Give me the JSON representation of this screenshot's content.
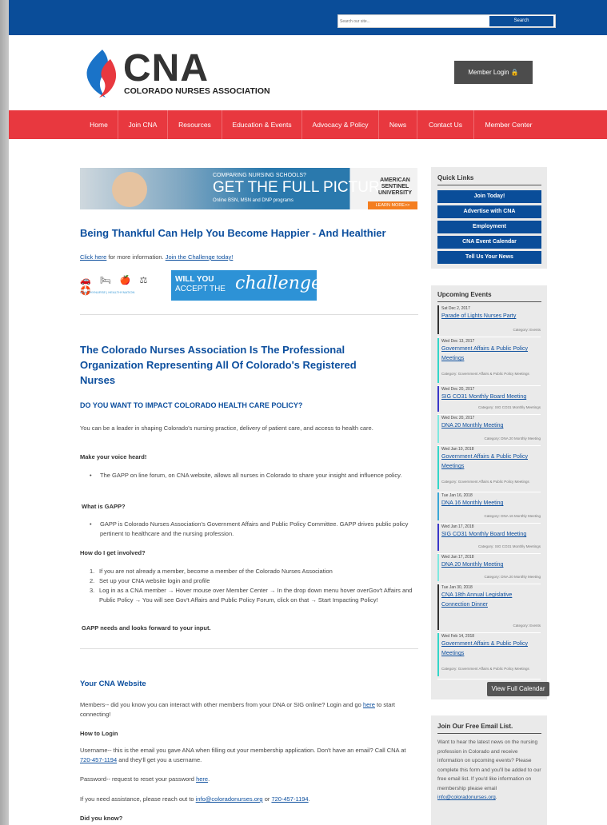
{
  "search": {
    "placeholder": "Search our site...",
    "button": "Search"
  },
  "logo": {
    "title": "CNA",
    "subtitle": "COLORADO NURSES ASSOCIATION"
  },
  "member_login": "Member Login 🔒",
  "nav": [
    "Home",
    "Join CNA",
    "Resources",
    "Education & Events",
    "Advocacy & Policy",
    "News",
    "Contact Us",
    "Member Center"
  ],
  "ad": {
    "line1": "COMPARING NURSING SCHOOLS?",
    "line2": "GET THE FULL PICTURE",
    "line3": "Online BSN, MSN and DNP programs",
    "brand": "AMERICAN SENTINEL UNIVERSITY",
    "cta": "LEARN MORE>>"
  },
  "headline1": "Being Thankful Can Help You Become Happier - And Healthier",
  "info": {
    "link1": "Click here",
    "mid": " for more information. ",
    "link2": "Join the Challenge today!"
  },
  "challenge": {
    "brand": "HEALTHYNURSE | HEALTHYNATION",
    "text1": "WILL YOU",
    "text2": "ACCEPT THE",
    "text3": "challenge?"
  },
  "headline2": "The Colorado Nurses Association Is The Professional Organization Representing All Of Colorado's Registered Nurses",
  "subhead": "DO YOU WANT TO IMPACT COLORADO HEALTH CARE POLICY?",
  "para1": "You can be a leader in shaping Colorado's nursing practice, delivery of patient care, and access to health care.",
  "voice_head": "Make your voice heard!",
  "voice_bullet": "The GAPP on line forum, on CNA website, allows all nurses in Colorado to share your insight and influence policy.",
  "gapp_head": "What is GAPP?",
  "gapp_bullet": "GAPP is Colorado Nurses Association's Government Affairs and Public Policy Committee. GAPP drives public policy pertinent to healthcare and the nursing profession.",
  "involved_head": "How do I get involved?",
  "steps": [
    "If you are not already a member, become a member of the Colorado Nurses Association",
    "Set up your CNA website login and profile",
    "Log in as a CNA member → Hover mouse over Member Center →  In the drop down menu hover overGov't Affairs and Public Policy → You will see  Gov't Affairs and Public Policy Forum, click on that → Start Impacting Policy!"
  ],
  "gapp_needs": "GAPP needs and looks forward to your input.",
  "website_head": "Your CNA Website",
  "website_para": "Members-- did you know you can interact with other members from your DNA or SIG online? Login and go",
  "website_here": "here",
  "website_tail": " to start connecting!",
  "login_head": "How to Login",
  "username_para": "Username-- this is the email you gave ANA when filling out your membership application. Don't have an email? Call CNA at ",
  "phone": "720-457-1194",
  "username_tail": " and they'll get you a username.",
  "password_para": "Password-- request to reset your password ",
  "password_here": "here",
  "assist_para": "If you need assistance, please reach out to ",
  "assist_email": "info@coloradonurses.org",
  "assist_or": " or ",
  "did_you_know": "Did you know?",
  "quick": {
    "title": "Quick Links",
    "links": [
      "Join Today!",
      "Advertise with CNA",
      "Employment",
      "CNA Event Calendar",
      "Tell Us Your News"
    ]
  },
  "events": {
    "title": "Upcoming Events",
    "button": "View Full Calendar",
    "items": [
      {
        "date": "Sat Dec 2, 2017",
        "title": "Parade of Lights Nurses Party",
        "cat": "Category: Events",
        "color": "#333333"
      },
      {
        "date": "Wed Dec 13, 2017",
        "title": "Government Affairs & Public Policy Meetings",
        "cat": "Category: Government Affairs & Public Policy Meetings",
        "color": "#33d6c9"
      },
      {
        "date": "Wed Dec 20, 2017",
        "title": "SIG CO31 Monthly Board Meeting",
        "cat": "Category: SIG CO31 Monthly Meetings",
        "color": "#3a36c9"
      },
      {
        "date": "Wed Dec 20, 2017",
        "title": "DNA 20 Monthly Meeting",
        "cat": "Category: DNA 20 Monthly Meeting",
        "color": "#7ee8e0"
      },
      {
        "date": "Wed Jan 10, 2018",
        "title": "Government Affairs & Public Policy Meetings",
        "cat": "Category: Government Affairs & Public Policy Meetings",
        "color": "#33d6c9"
      },
      {
        "date": "Tue Jan 16, 2018",
        "title": "DNA 16 Monthly Meeting",
        "cat": "Category: DNA 16 Monthly Meeting",
        "color": "#3aa7d6"
      },
      {
        "date": "Wed Jan 17, 2018",
        "title": "SIG CO31 Monthly Board Meeting",
        "cat": "Category: SIG CO31 Monthly Meetings",
        "color": "#3a36c9"
      },
      {
        "date": "Wed Jan 17, 2018",
        "title": "DNA 20 Monthly Meeting",
        "cat": "Category: DNA 20 Monthly Meeting",
        "color": "#7ee8e0"
      },
      {
        "date": "Tue Jan 30, 2018",
        "title": "CNA 18th Annual Legislative Connection Dinner",
        "cat": "Category: Events",
        "color": "#333333"
      },
      {
        "date": "Wed Feb 14, 2018",
        "title": "Government Affairs & Public Policy Meetings",
        "cat": "Category: Government Affairs & Public Policy Meetings",
        "color": "#33d6c9"
      }
    ]
  },
  "email_list": {
    "title": "Join Our Free Email List.",
    "text": "Want to hear the latest news on the nursing profession in Colorado and receive information on upcoming events? Please complete this form and you'll be added to our free email list. If you'd like information on membership please email",
    "email": "info@coloradonurses.org"
  }
}
